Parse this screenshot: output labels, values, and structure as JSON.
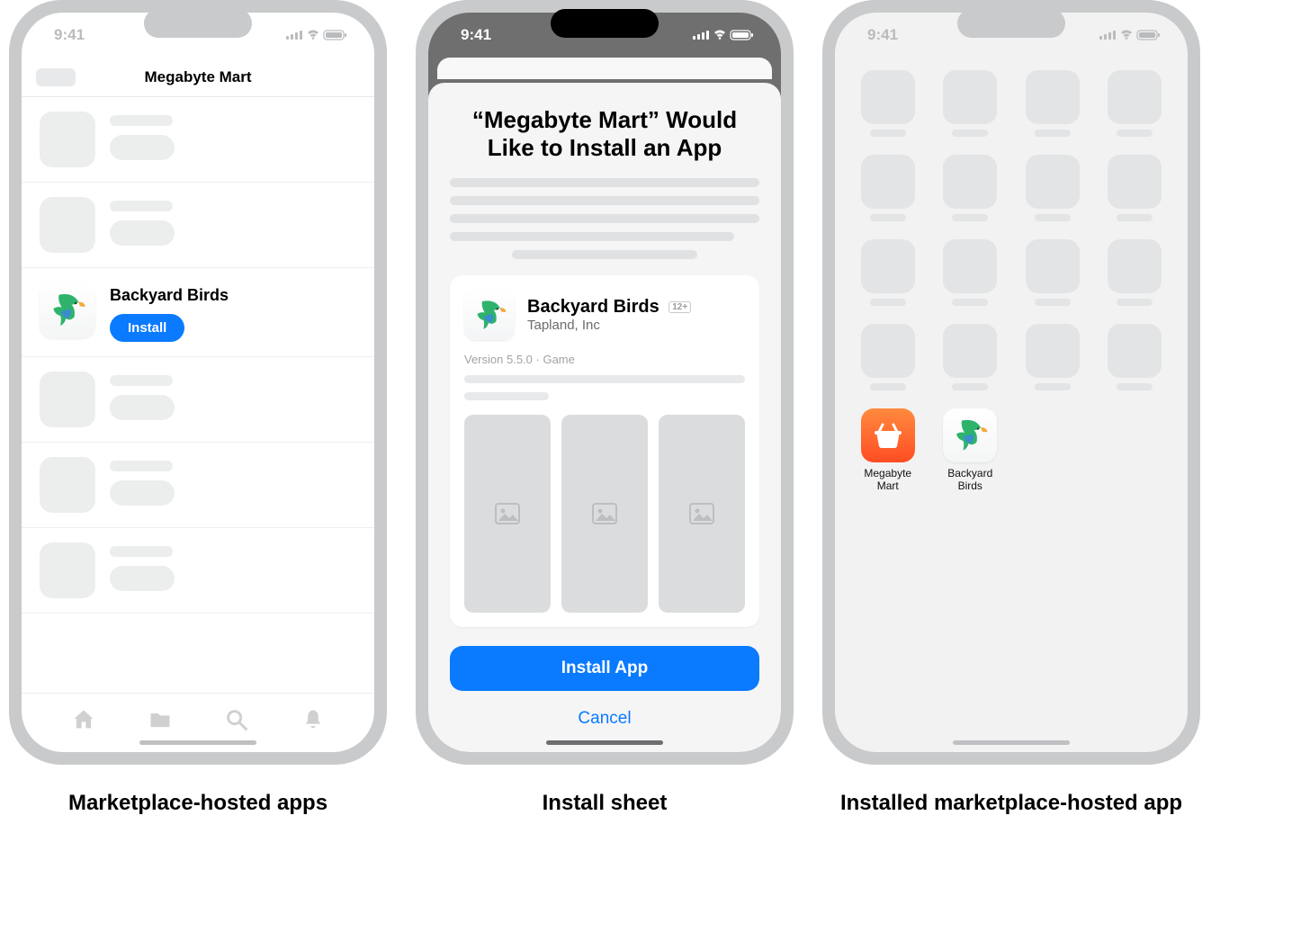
{
  "status": {
    "time": "9:41"
  },
  "screens": {
    "marketplace": {
      "title": "Megabyte Mart",
      "featured_app": "Backyard Birds",
      "install_label": "Install",
      "caption": "Marketplace-hosted apps"
    },
    "sheet": {
      "title": "“Megabyte Mart” Would Like to Install an App",
      "app": {
        "name": "Backyard Birds",
        "age": "12+",
        "developer": "Tapland, Inc",
        "version": "Version 5.5.0",
        "category": "Game"
      },
      "primary": "Install App",
      "cancel": "Cancel",
      "caption": "Install sheet"
    },
    "home": {
      "apps": {
        "marketplace": "Megabyte Mart",
        "installed": "Backyard Birds"
      },
      "caption": "Installed marketplace-hosted app"
    }
  }
}
